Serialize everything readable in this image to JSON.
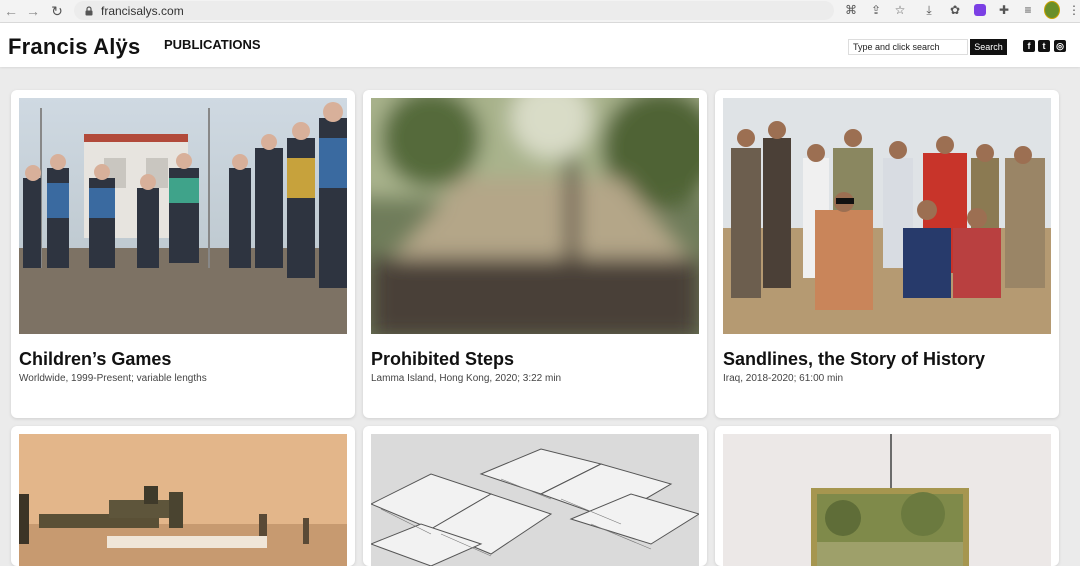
{
  "browser": {
    "url": "francisalys.com"
  },
  "site": {
    "brand": "Francis Alÿs",
    "nav": [
      {
        "label": "PUBLICATIONS"
      }
    ],
    "search": {
      "placeholder": "Type and click search",
      "button_label": "Search"
    },
    "social": [
      {
        "icon": "facebook-icon",
        "glyph": "f"
      },
      {
        "icon": "twitter-icon",
        "glyph": "t"
      },
      {
        "icon": "instagram-icon",
        "glyph": "◎"
      }
    ]
  },
  "works": [
    {
      "title": "Children’s Games",
      "meta": "Worldwide, 1999-Present; variable lengths"
    },
    {
      "title": "Prohibited Steps",
      "meta": "Lamma Island, Hong Kong, 2020; 3:22 min"
    },
    {
      "title": "Sandlines, the Story of History",
      "meta": "Iraq, 2018-2020; 61:00 min"
    },
    {
      "title": "",
      "meta": ""
    },
    {
      "title": "",
      "meta": ""
    },
    {
      "title": "",
      "meta": ""
    }
  ]
}
